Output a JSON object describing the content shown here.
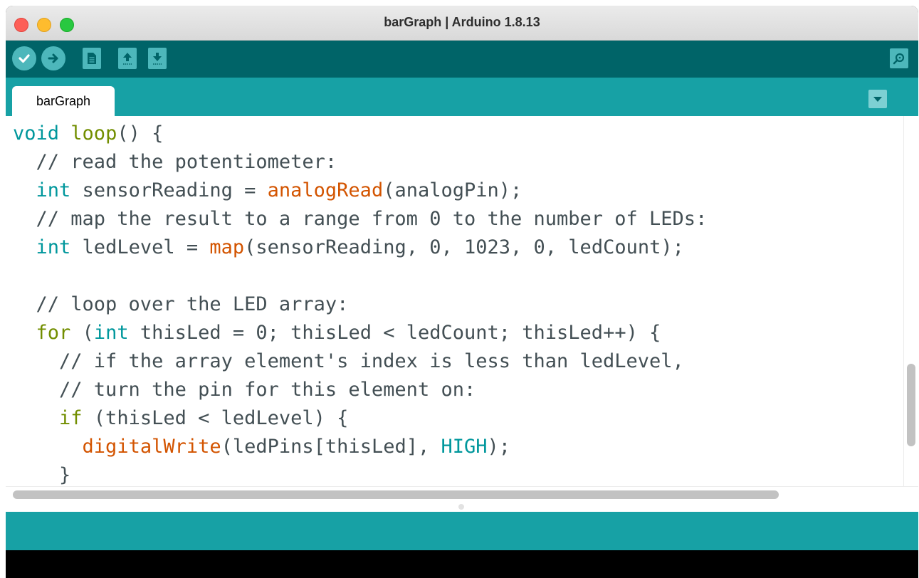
{
  "window": {
    "title": "barGraph | Arduino 1.8.13"
  },
  "toolbar": {
    "buttons": [
      {
        "name": "verify",
        "icon": "checkmark-icon"
      },
      {
        "name": "upload",
        "icon": "arrow-right-icon"
      },
      {
        "name": "new",
        "icon": "document-icon"
      },
      {
        "name": "open",
        "icon": "arrow-up-icon"
      },
      {
        "name": "save",
        "icon": "arrow-down-icon"
      },
      {
        "name": "serial-monitor",
        "icon": "magnifier-icon"
      }
    ]
  },
  "tabs": [
    {
      "label": "barGraph",
      "active": true
    }
  ],
  "code": {
    "lines": [
      "void loop() {",
      "  // read the potentiometer:",
      "  int sensorReading = analogRead(analogPin);",
      "  // map the result to a range from 0 to the number of LEDs:",
      "  int ledLevel = map(sensorReading, 0, 1023, 0, ledCount);",
      "",
      "  // loop over the LED array:",
      "  for (int thisLed = 0; thisLed < ledCount; thisLed++) {",
      "    // if the array element's index is less than ledLevel,",
      "    // turn the pin for this element on:",
      "    if (thisLed < ledLevel) {",
      "      digitalWrite(ledPins[thisLed], HIGH);",
      "    }"
    ]
  },
  "colors": {
    "toolbar": "#006468",
    "tabbar": "#17a1a5",
    "keyword": "#00979c",
    "control": "#728e00",
    "function": "#d35400",
    "text": "#434f54"
  }
}
